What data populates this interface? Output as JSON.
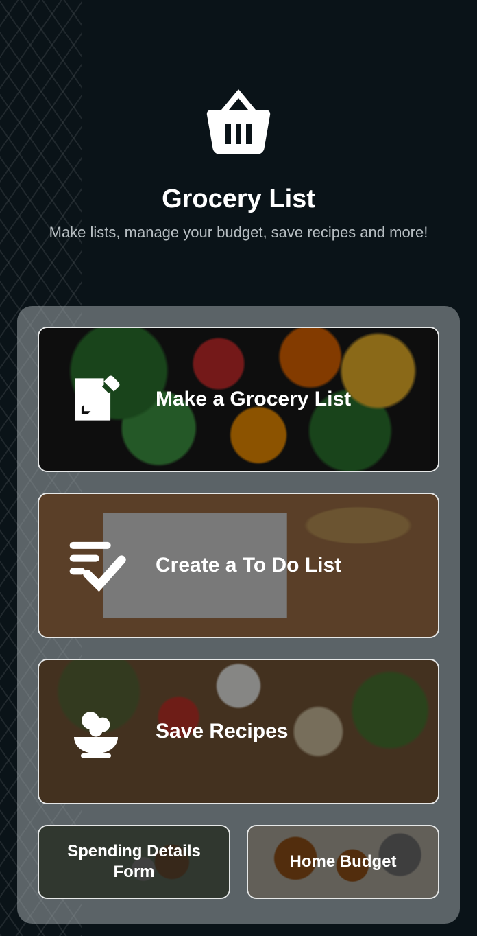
{
  "hero": {
    "icon": "basket-icon",
    "title": "Grocery List",
    "subtitle": "Make lists, manage your budget, save recipes and more!"
  },
  "cards": {
    "grocery": {
      "label": "Make a Grocery List",
      "icon": "pencil-square-icon"
    },
    "todo": {
      "label": "Create a To Do List",
      "icon": "checklist-icon"
    },
    "recipes": {
      "label": "Save Recipes",
      "icon": "noodle-bowl-icon"
    }
  },
  "smallCards": {
    "spending": {
      "label": "Spending Details Form"
    },
    "budget": {
      "label": "Home Budget"
    }
  }
}
